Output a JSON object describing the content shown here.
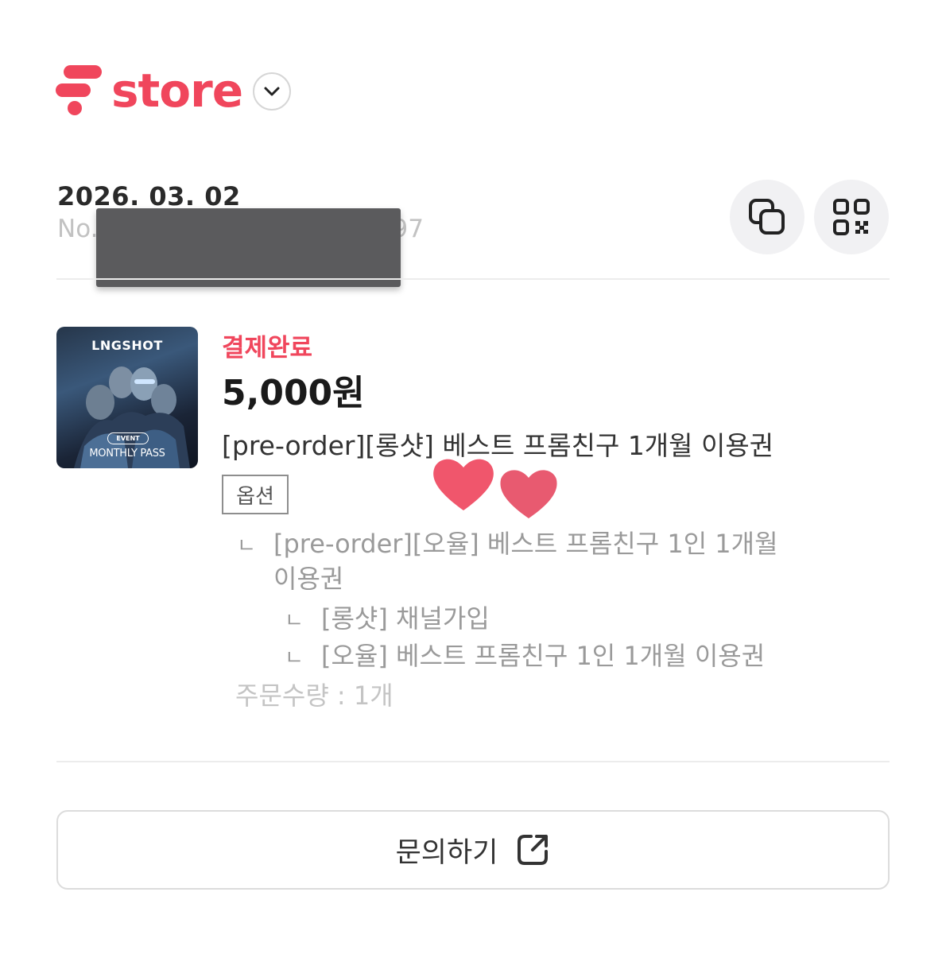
{
  "header": {
    "logo_text": "store",
    "brand_color": "#f0465c"
  },
  "order": {
    "date": "2026. 03. 02",
    "number_visible": "No.",
    "number_suffix": "97",
    "copy_icon": "copy-icon",
    "qr_icon": "qr-code-icon"
  },
  "item": {
    "thumbnail": {
      "brand": "LNGSHOT",
      "badge": "EVENT",
      "footer": "MONTHLY PASS"
    },
    "status": "결제완료",
    "price": "5,000원",
    "name": "[pre-order][롱샷] 베스트 프롬친구 1개월 이용권",
    "option_tag": "옵션",
    "options": {
      "mark": "ㄴ",
      "main_line1": "[pre-order][오율] 베스트 프롬친구 1인 1개월",
      "main_line2": "이용권",
      "sub1": "[롱샷] 채널가입",
      "sub2": "[오율] 베스트 프롬친구 1인 1개월 이용권"
    },
    "quantity": "주문수량 : 1개"
  },
  "inquiry": {
    "label": "문의하기",
    "icon": "external-link-icon"
  }
}
